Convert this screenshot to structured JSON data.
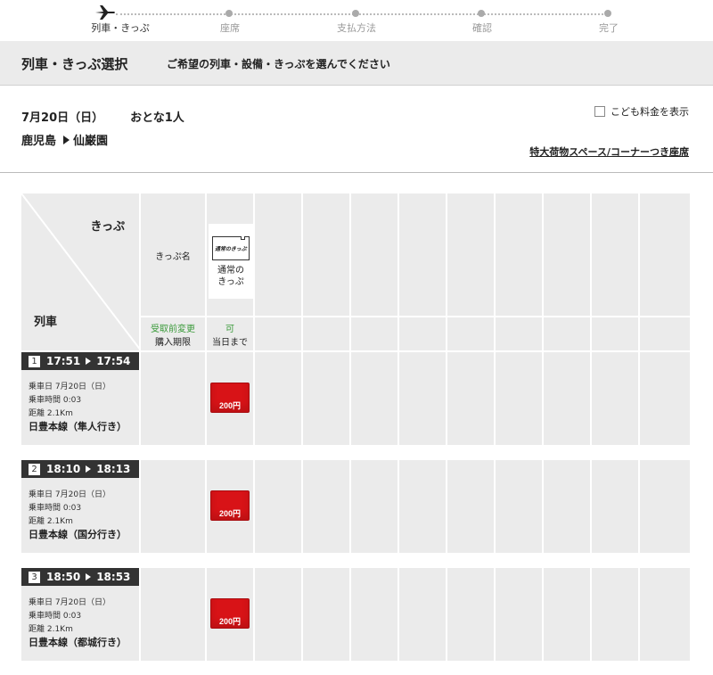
{
  "steps": [
    {
      "label": "列車・きっぷ",
      "active": true
    },
    {
      "label": "座席",
      "active": false
    },
    {
      "label": "支払方法",
      "active": false
    },
    {
      "label": "確認",
      "active": false
    },
    {
      "label": "完了",
      "active": false
    }
  ],
  "header": {
    "title": "列車・きっぷ選択",
    "subtitle": "ご希望の列車・設備・きっぷを選んでください"
  },
  "trip": {
    "date": "7月20日（日）",
    "passengers": "おとな1人",
    "from": "鹿児島",
    "to": "仙巌園",
    "child_fare_label": "こども料金を表示",
    "special_luggage_link": "特大荷物スペース/コーナーつき座席"
  },
  "grid": {
    "corner_ticket": "きっぷ",
    "corner_train": "列車",
    "ticket_name_label": "きっぷ名",
    "change_label": "受取前変更",
    "purchase_limit_label": "購入期限",
    "ticket": {
      "icon_text": "通常のきっぷ",
      "name_line1": "通常の",
      "name_line2": "きっぷ",
      "change_ok": "可",
      "limit": "当日まで"
    },
    "colors": {
      "accent": "#d81317",
      "ok_green": "#3a9a3a",
      "dark_bar": "#333333"
    }
  },
  "trains": [
    {
      "no": "1",
      "dep": "17:51",
      "arr": "17:54",
      "date": "乗車日 7月20日（日）",
      "duration": "乗車時間 0:03",
      "distance": "距離 2.1Km",
      "line": "日豊本線（隼人行き）",
      "price": "200円"
    },
    {
      "no": "2",
      "dep": "18:10",
      "arr": "18:13",
      "date": "乗車日 7月20日（日）",
      "duration": "乗車時間 0:03",
      "distance": "距離 2.1Km",
      "line": "日豊本線（国分行き）",
      "price": "200円"
    },
    {
      "no": "3",
      "dep": "18:50",
      "arr": "18:53",
      "date": "乗車日 7月20日（日）",
      "duration": "乗車時間 0:03",
      "distance": "距離 2.1Km",
      "line": "日豊本線（都城行き）",
      "price": "200円"
    }
  ]
}
